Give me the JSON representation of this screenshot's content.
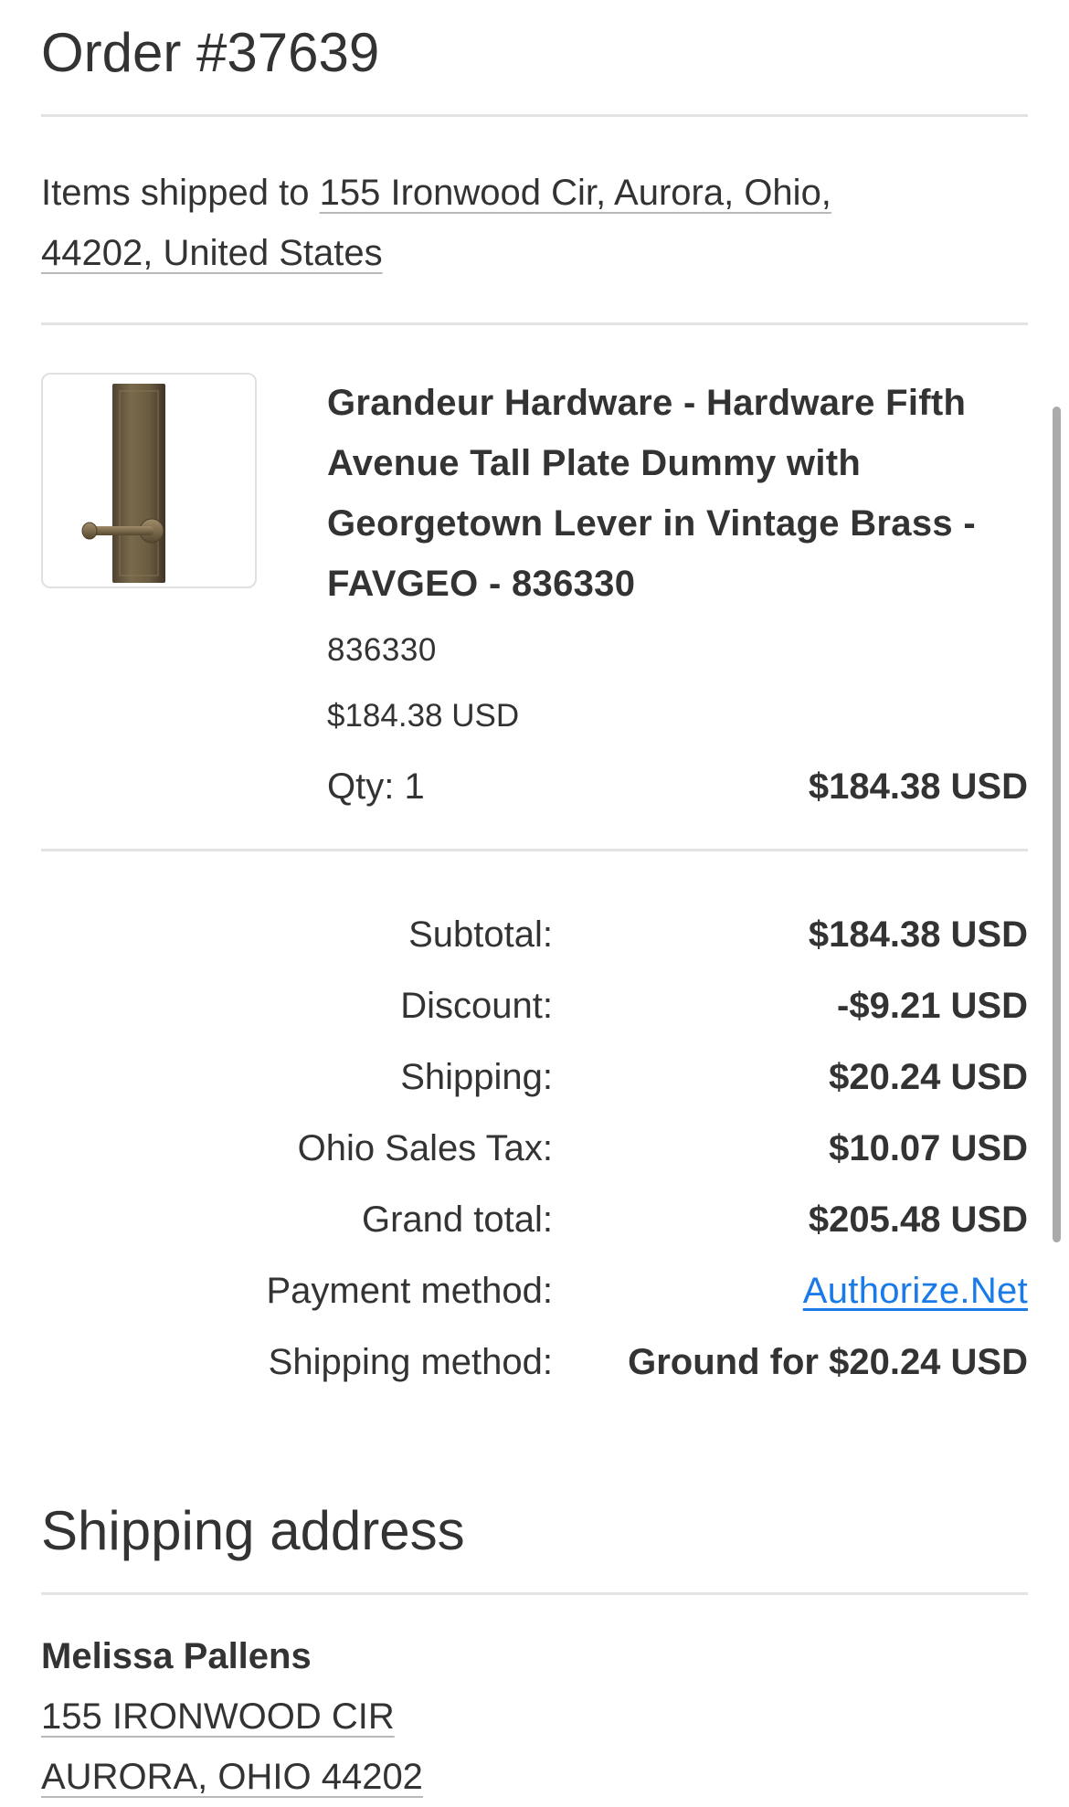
{
  "order": {
    "title": "Order #37639"
  },
  "shipped_to": {
    "prefix": "Items shipped to ",
    "address_line1": "155 Ironwood Cir, Aurora, Ohio,",
    "address_line2": "44202, United States"
  },
  "item": {
    "image_icon": "door-lever-plate-image",
    "name": "Grandeur Hardware - Hardware Fifth Avenue Tall Plate Dummy with Georgetown Lever in Vintage Brass - FAVGEO - 836330",
    "sku": "836330",
    "unit_price": "$184.38 USD",
    "qty": "Qty: 1",
    "line_total": "$184.38 USD"
  },
  "totals": [
    {
      "label": "Subtotal:",
      "value": "$184.38 USD"
    },
    {
      "label": "Discount:",
      "value": "-$9.21 USD"
    },
    {
      "label": "Shipping:",
      "value": "$20.24 USD"
    },
    {
      "label": "Ohio Sales Tax:",
      "value": "$10.07 USD"
    },
    {
      "label": "Grand total:",
      "value": "$205.48 USD"
    },
    {
      "label": "Payment method:",
      "value": "Authorize.Net"
    },
    {
      "label": "Shipping method:",
      "value": "Ground for $20.24 USD"
    }
  ],
  "shipping_address": {
    "heading": "Shipping address",
    "name": "Melissa Pallens",
    "line1": "155 IRONWOOD CIR",
    "line2": "AURORA, OHIO 44202"
  },
  "colors": {
    "text": "#333333",
    "link": "#1a7ae8",
    "divider": "#e3e3e3"
  }
}
